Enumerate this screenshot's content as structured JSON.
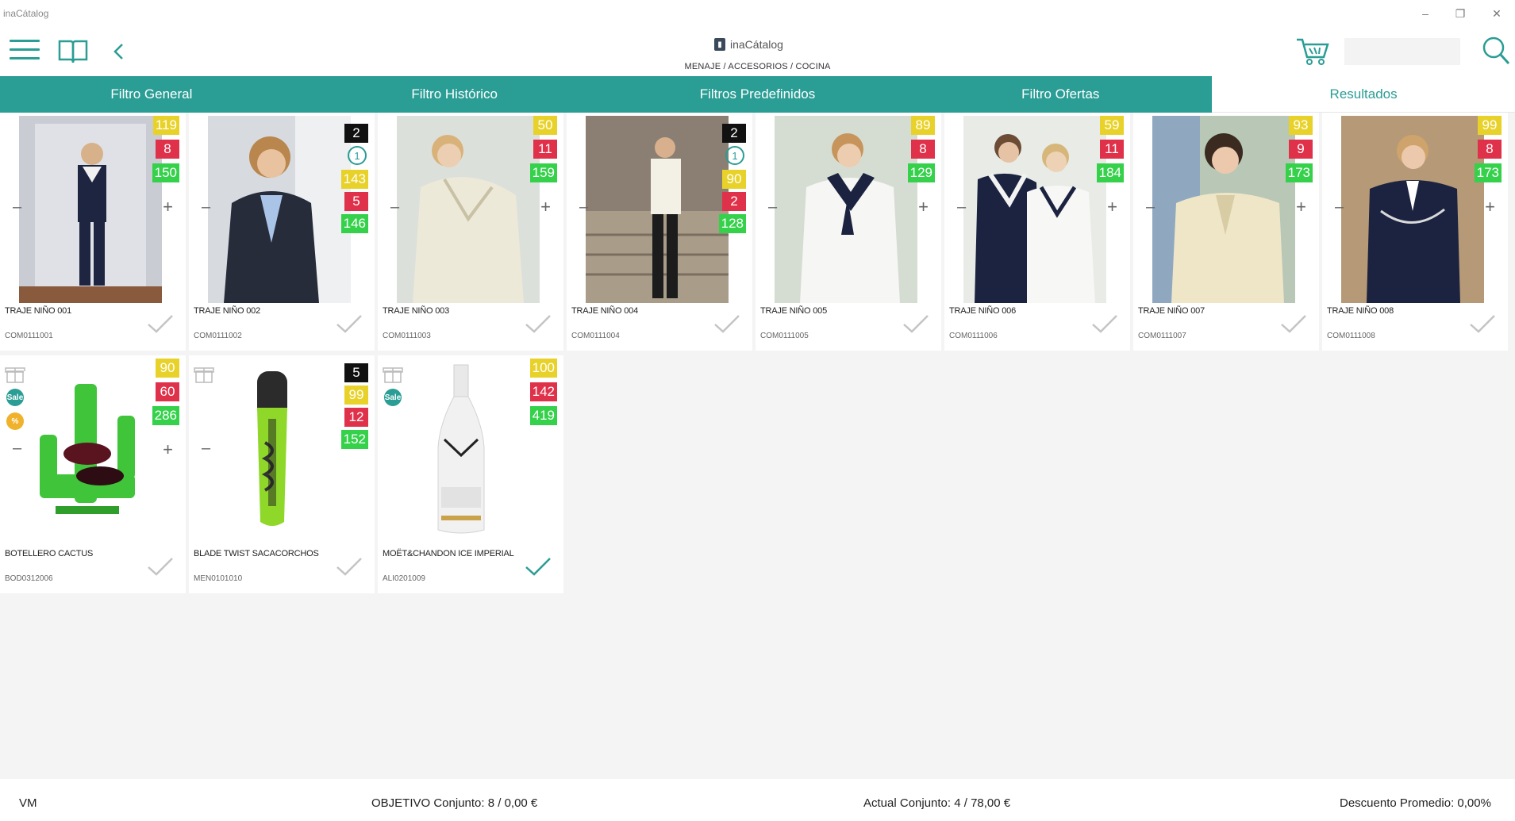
{
  "window": {
    "title": "inaCátalog"
  },
  "header": {
    "brand": "inaCátalog",
    "breadcrumb": "MENAJE / ACCESORIOS / COCINA",
    "search": {
      "value": "",
      "placeholder": ""
    }
  },
  "tabs": [
    {
      "label": "Filtro General"
    },
    {
      "label": "Filtro Histórico"
    },
    {
      "label": "Filtros Predefinidos"
    },
    {
      "label": "Filtro Ofertas"
    },
    {
      "label": "Resultados"
    }
  ],
  "products": [
    {
      "name": "TRAJE NIÑO 001",
      "code": "COM0111001",
      "badges": [
        "119",
        "8",
        "150"
      ],
      "selected": false
    },
    {
      "name": "TRAJE NIÑO 002",
      "code": "COM0111002",
      "badges": [
        "2",
        "1",
        "143",
        "5",
        "146"
      ],
      "selected": false
    },
    {
      "name": "TRAJE NIÑO 003",
      "code": "COM0111003",
      "badges": [
        "50",
        "11",
        "159"
      ],
      "selected": false
    },
    {
      "name": "TRAJE NIÑO 004",
      "code": "COM0111004",
      "badges": [
        "2",
        "1",
        "90",
        "2",
        "128"
      ],
      "selected": false
    },
    {
      "name": "TRAJE NIÑO 005",
      "code": "COM0111005",
      "badges": [
        "89",
        "8",
        "129"
      ],
      "selected": false
    },
    {
      "name": "TRAJE NIÑO 006",
      "code": "COM0111006",
      "badges": [
        "59",
        "11",
        "184"
      ],
      "selected": false
    },
    {
      "name": "TRAJE NIÑO 007",
      "code": "COM0111007",
      "badges": [
        "93",
        "9",
        "173"
      ],
      "selected": false
    },
    {
      "name": "TRAJE NIÑO 008",
      "code": "COM0111008",
      "badges": [
        "99",
        "8",
        "173"
      ],
      "selected": false
    },
    {
      "name": "BOTELLERO CACTUS",
      "code": "BOD0312006",
      "badges": [
        "90",
        "60",
        "286"
      ],
      "selected": false,
      "round_badges": [
        "Sale",
        "%"
      ]
    },
    {
      "name": "BLADE TWIST SACACORCHOS",
      "code": "MEN0101010",
      "badges": [
        "5",
        "99",
        "12",
        "152"
      ],
      "selected": false
    },
    {
      "name": "MOËT&CHANDON ICE IMPERIAL",
      "code": "ALI0201009",
      "badges": [
        "100",
        "142",
        "419"
      ],
      "selected": true,
      "round_badges": [
        "Sale"
      ]
    }
  ],
  "footer": {
    "user": "VM",
    "objetivo": "OBJETIVO Conjunto: 8 / 0,00 €",
    "actual": "Actual Conjunto: 4 / 78,00 €",
    "descuento": "Descuento Promedio: 0,00%"
  },
  "colors": {
    "accent": "#2a9d94",
    "yellow": "#e8d22a",
    "red": "#e0314a",
    "green": "#35d14b"
  },
  "icons": [
    "hamburger-icon",
    "book-icon",
    "back-icon",
    "cart-icon",
    "search-icon",
    "gift-icon",
    "check-icon"
  ]
}
